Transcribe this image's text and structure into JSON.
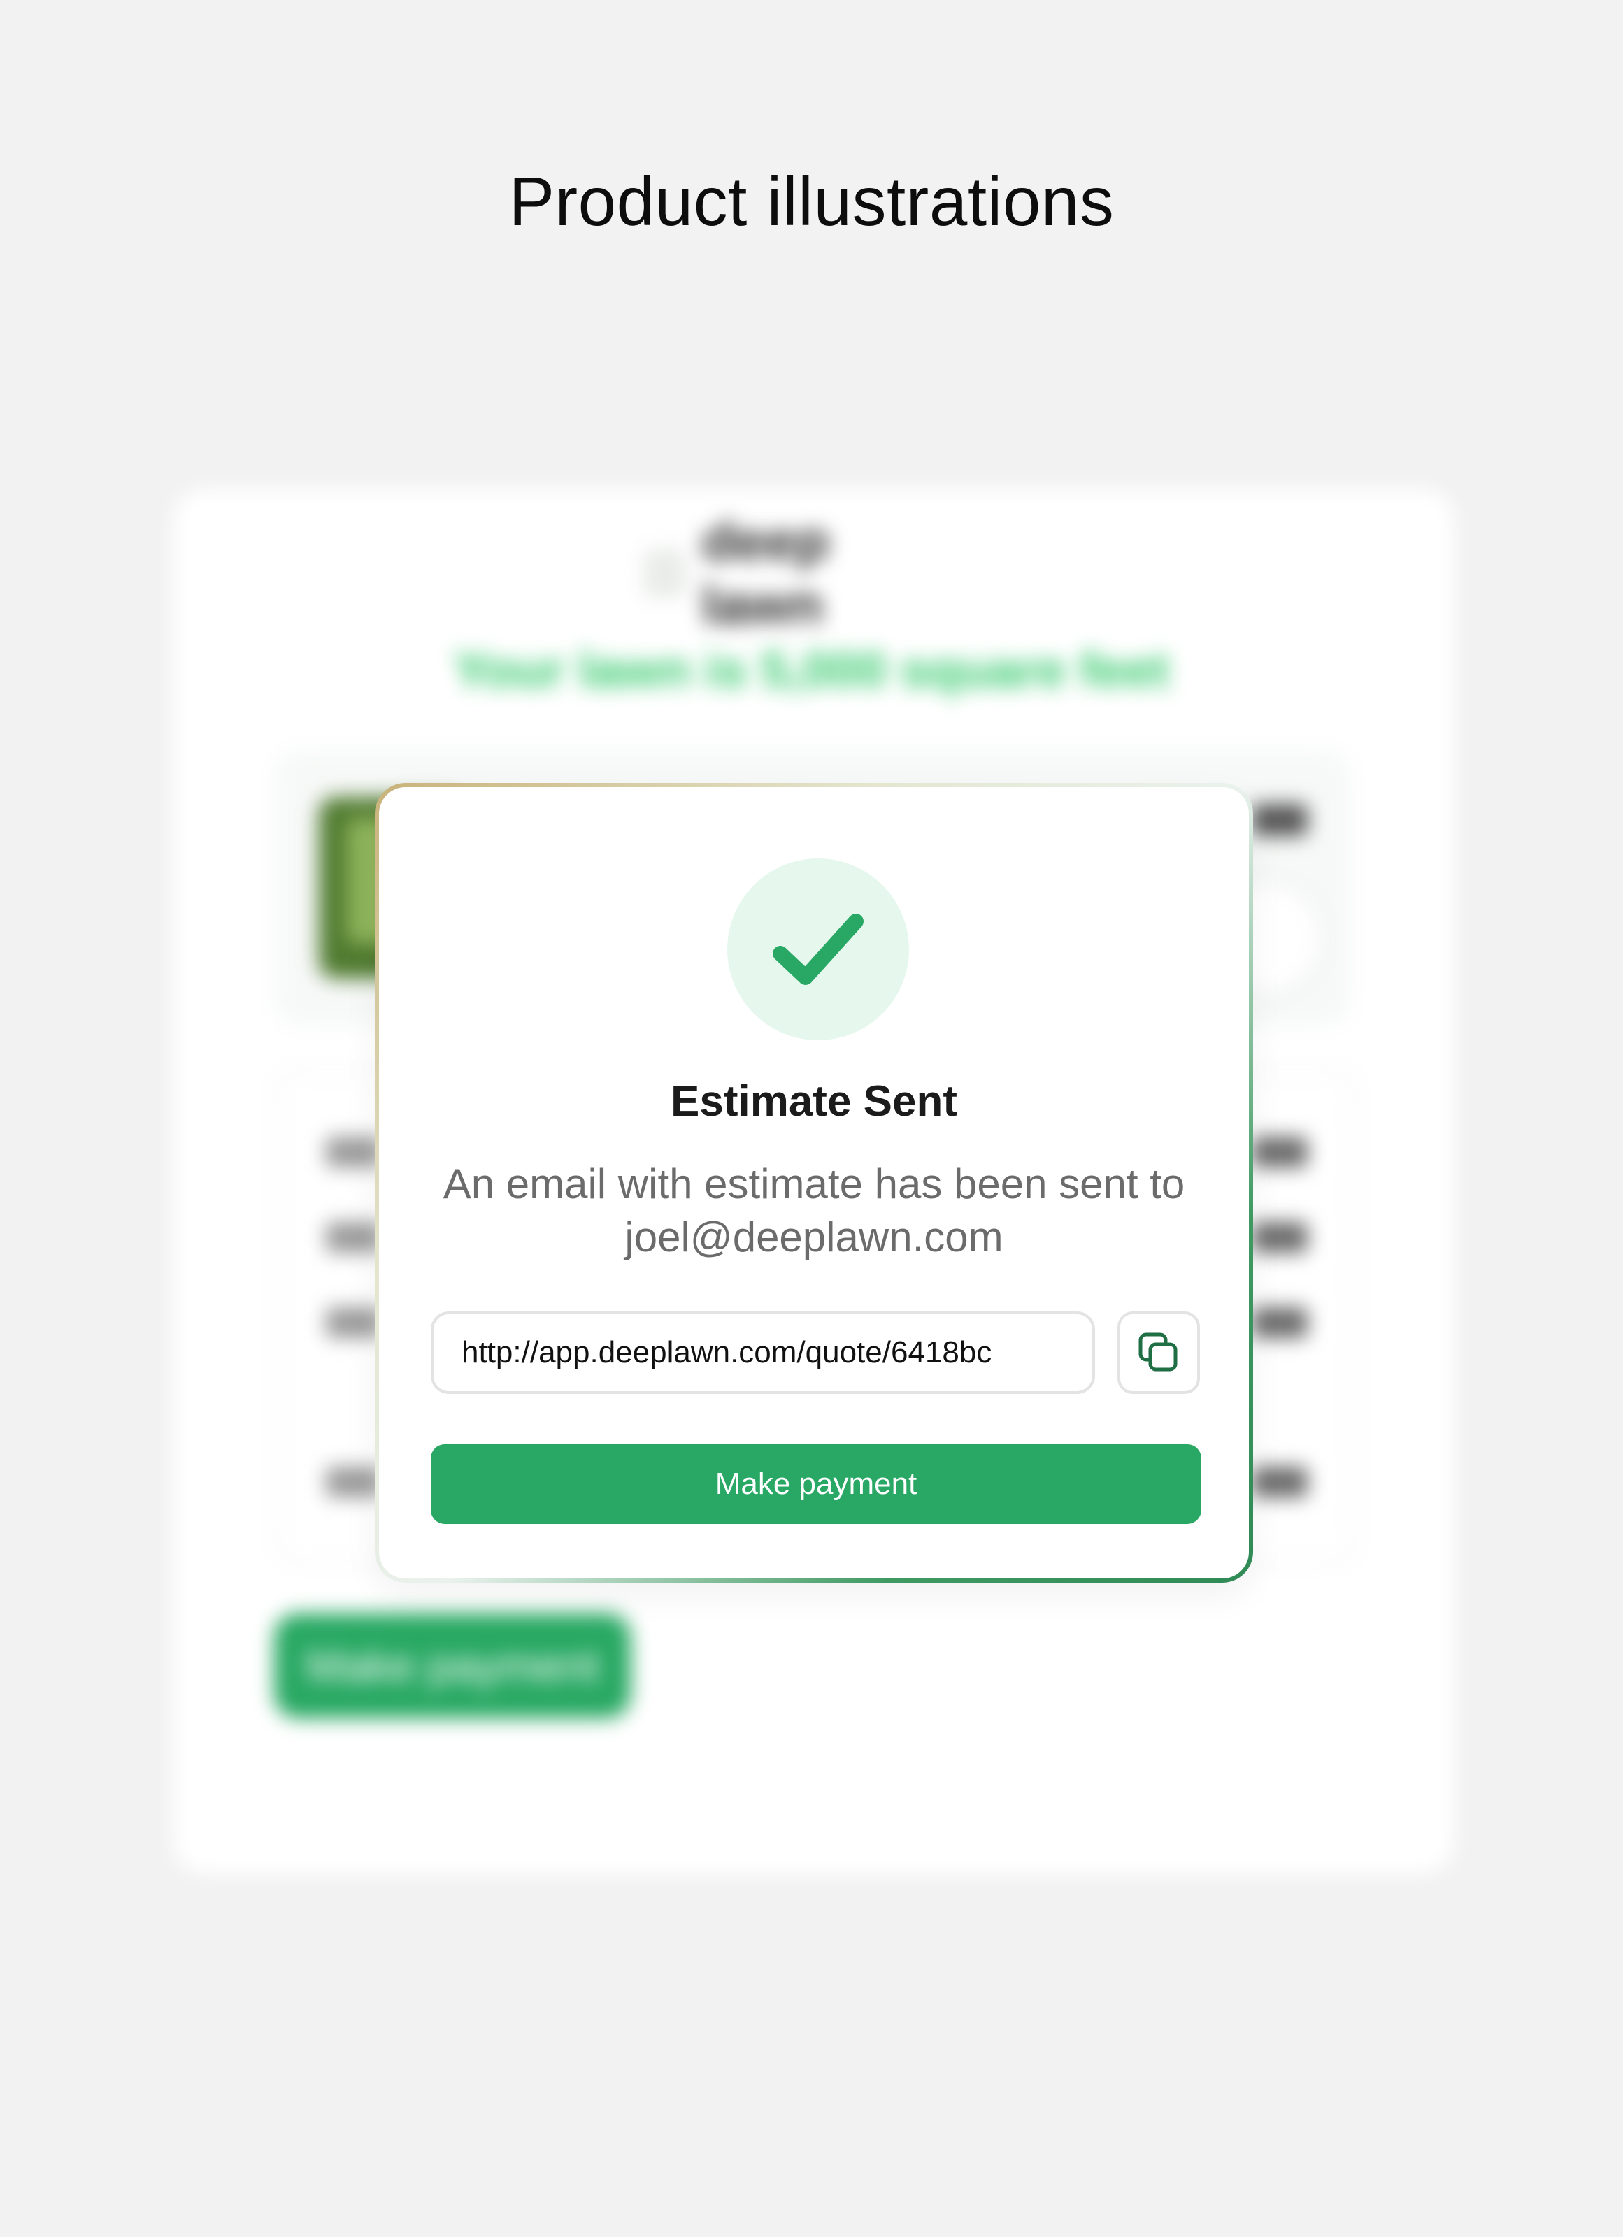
{
  "page": {
    "title": "Product illustrations"
  },
  "background_card": {
    "brand": "deep lawn",
    "headline": "Your lawn is 5,000 square feet",
    "button_label": "Make payment"
  },
  "modal": {
    "title": "Estimate Sent",
    "message": "An email with estimate has been sent to joel@deeplawn.com",
    "url_value": "http://app.deeplawn.com/quote/6418bc",
    "copy_icon": "copy-icon",
    "status_icon": "checkmark-icon",
    "button_label": "Make payment"
  },
  "colors": {
    "page_background": "#f2f2f2",
    "accent_green": "#28a864",
    "check_circle_bg": "#e6f8ee",
    "headline_green": "#34c96c"
  }
}
